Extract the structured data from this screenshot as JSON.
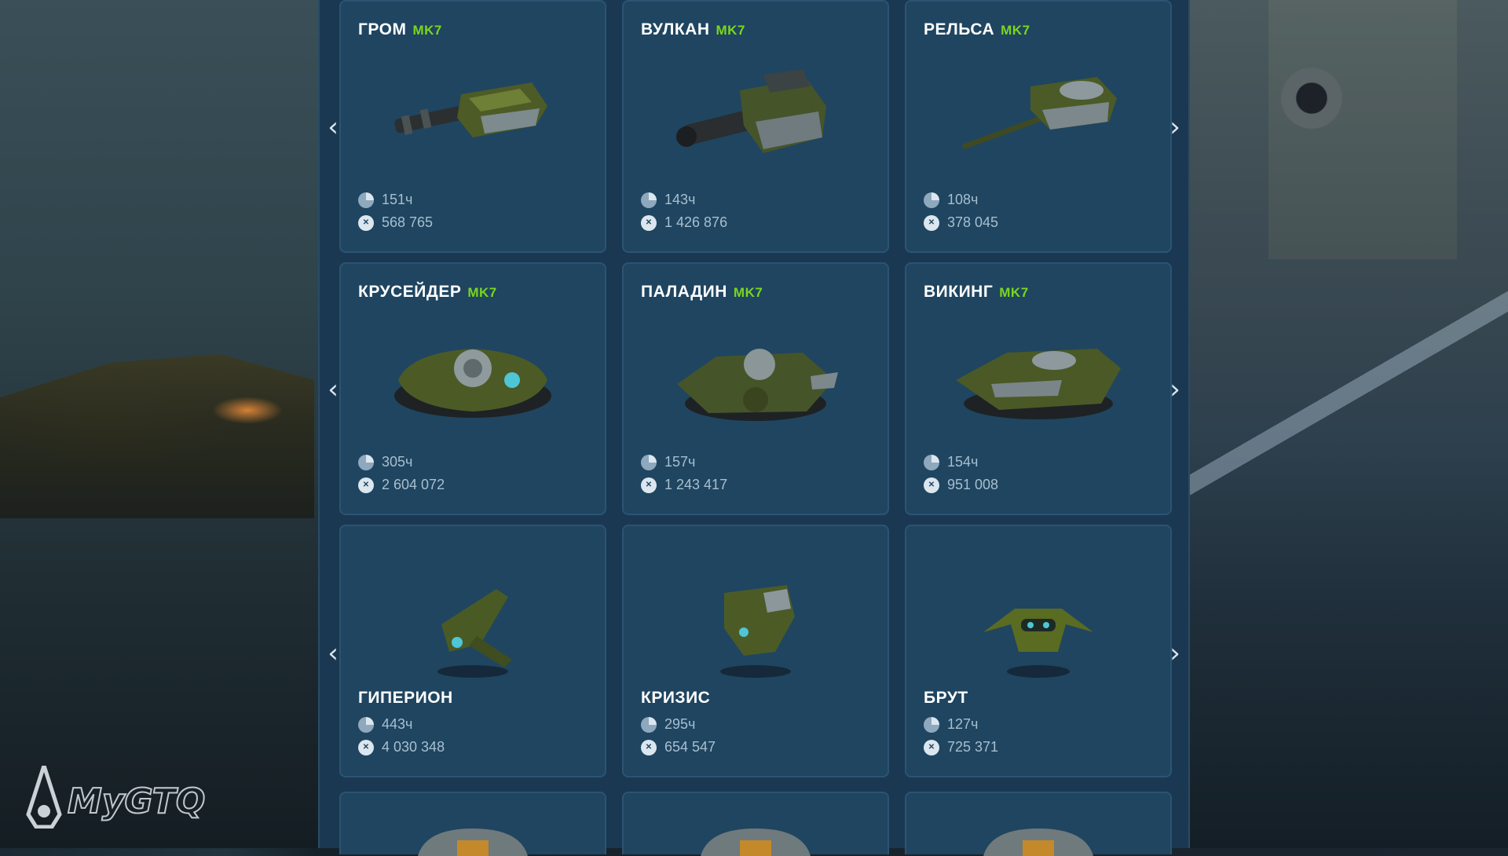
{
  "rows": [
    {
      "cards": [
        {
          "name": "ГРОМ",
          "mk": "MK7",
          "time": "151ч",
          "xp": "568 765"
        },
        {
          "name": "ВУЛКАН",
          "mk": "MK7",
          "time": "143ч",
          "xp": "1 426 876"
        },
        {
          "name": "РЕЛЬСА",
          "mk": "MK7",
          "time": "108ч",
          "xp": "378 045"
        }
      ]
    },
    {
      "cards": [
        {
          "name": "КРУСЕЙДЕР",
          "mk": "MK7",
          "time": "305ч",
          "xp": "2 604 072"
        },
        {
          "name": "ПАЛАДИН",
          "mk": "MK7",
          "time": "157ч",
          "xp": "1 243 417"
        },
        {
          "name": "ВИКИНГ",
          "mk": "MK7",
          "time": "154ч",
          "xp": "951 008"
        }
      ]
    },
    {
      "cards": [
        {
          "name": "ГИПЕРИОН",
          "time": "443ч",
          "xp": "4 030 348"
        },
        {
          "name": "КРИЗИС",
          "time": "295ч",
          "xp": "654 547"
        },
        {
          "name": "БРУТ",
          "time": "127ч",
          "xp": "725 371"
        }
      ]
    }
  ],
  "icons": {
    "prev": "chevron-left-icon",
    "next": "chevron-right-icon",
    "time": "clock-icon",
    "xp": "xp-icon"
  },
  "colors": {
    "panel": "#1b3852",
    "card": "#1f4560",
    "mk": "#7ad61e",
    "stat": "#a8bfd0"
  },
  "logo": {
    "text": "MyGTQ"
  }
}
